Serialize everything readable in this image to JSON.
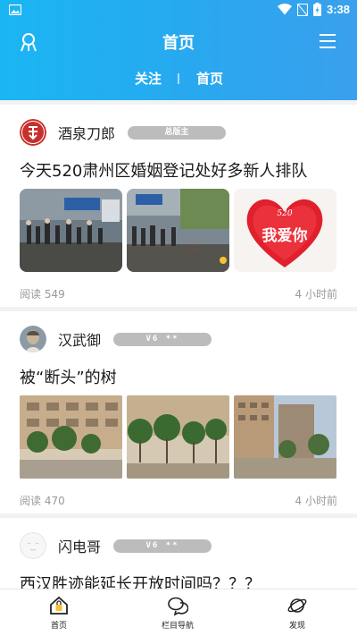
{
  "status": {
    "time": "3:38"
  },
  "header": {
    "title": "首页",
    "tabs": [
      "关注",
      "首页"
    ]
  },
  "posts": [
    {
      "author": "酒泉刀郎",
      "badge": "总版主",
      "title": "今天520肃州区婚姻登记处好多新人排队",
      "reads": "阅读 549",
      "time": "4 小时前",
      "image_overlay": "我爱你"
    },
    {
      "author": "汉武御",
      "badge": "V6 **",
      "title": "被“断头”的树",
      "reads": "阅读 470",
      "time": "4 小时前"
    },
    {
      "author": "闪电哥",
      "badge": "V6 **",
      "title": "西汉胜迹能延长开放时间吗？？？"
    }
  ],
  "bottom_nav": [
    {
      "label": "首页",
      "icon": "home-lock-icon"
    },
    {
      "label": "栏目导航",
      "icon": "chat-bubbles-icon"
    },
    {
      "label": "发现",
      "icon": "planet-icon"
    }
  ],
  "colors": {
    "header_start": "#1ab6f3",
    "header_end": "#3aa0ee",
    "badge": "#bcbcbc"
  }
}
